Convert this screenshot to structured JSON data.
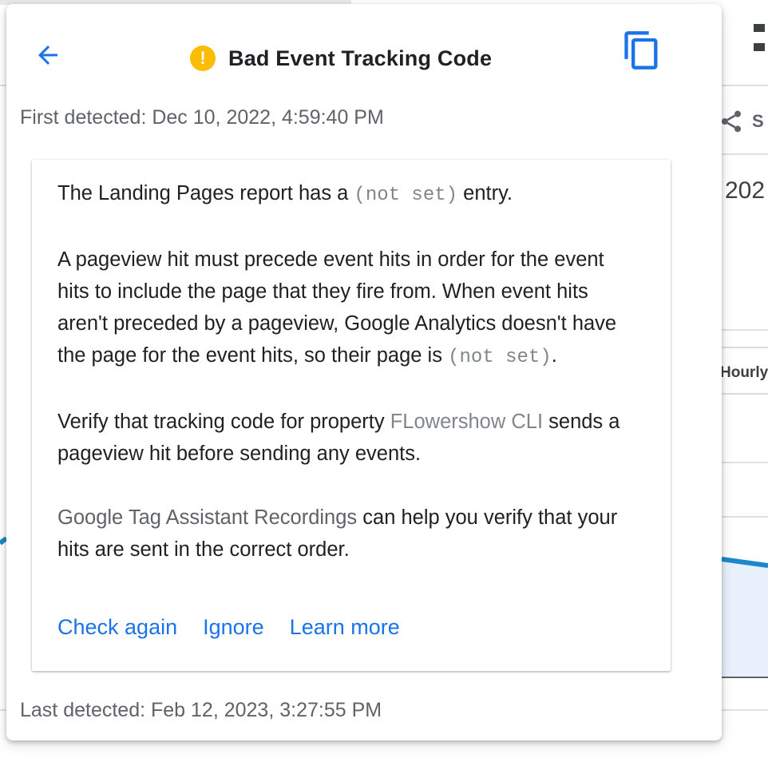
{
  "background": {
    "share_label": "S",
    "year_label": "202",
    "hourly_label": "Hourly"
  },
  "dialog": {
    "title": "Bad Event Tracking Code",
    "warning_glyph": "!",
    "first_detected": "First detected: Dec 10, 2022, 4:59:40 PM",
    "last_detected": "Last detected: Feb 12, 2023, 3:27:55 PM",
    "icons": {
      "back": "arrow-back-icon",
      "copy": "copy-icon",
      "warning": "warning-icon"
    },
    "colors": {
      "accent": "#1a73e8",
      "warning": "#fbbc04",
      "muted_text": "#5f6368"
    }
  },
  "card": {
    "p1_before": "The Landing Pages report has a ",
    "p1_code": "(not set)",
    "p1_after": " entry.",
    "p2_text": "A pageview hit must precede event hits in order for the event hits to include the page that they fire from. When event hits aren't preceded by a pageview, Google Analytics doesn't have the page for the event hits, so their page is ",
    "p2_code": "(not set)",
    "p2_after": ".",
    "p3_before": "Verify that tracking code for property ",
    "p3_property": "FLowershow CLI",
    "p3_after": " sends a pageview hit before sending any events.",
    "p4_link": "Google Tag Assistant Recordings",
    "p4_after": " can help you verify that your hits are sent in the correct order.",
    "actions": {
      "check_again": "Check again",
      "ignore": "Ignore",
      "learn_more": "Learn more"
    }
  }
}
